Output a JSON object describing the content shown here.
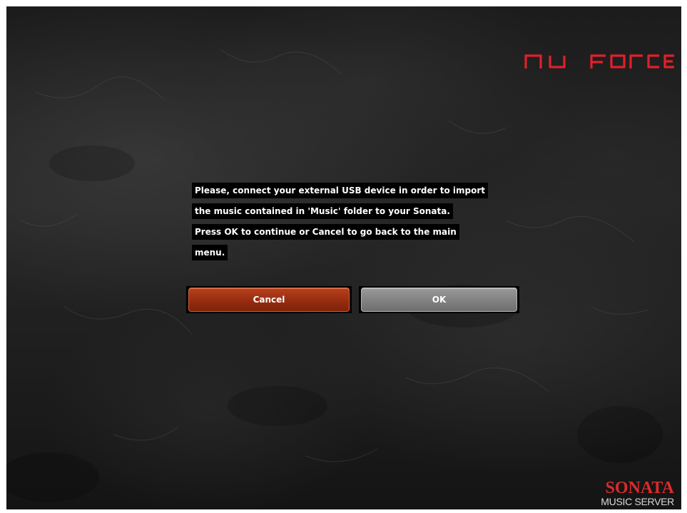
{
  "header": {
    "logo_text": "nu force",
    "logo_color": "#e0202a"
  },
  "dialog": {
    "lines": [
      "Please, connect your external USB device in order to import",
      "the music contained in 'Music' folder to your Sonata.",
      "Press OK to continue or Cancel to go back to the main",
      "menu."
    ],
    "cancel_label": "Cancel",
    "ok_label": "OK",
    "cancel_color": "#9a2e10",
    "ok_color": "#838383"
  },
  "footer": {
    "brand_title": "SONATA",
    "brand_subtitle": "MUSIC SERVER",
    "brand_color": "#d72c2c"
  }
}
